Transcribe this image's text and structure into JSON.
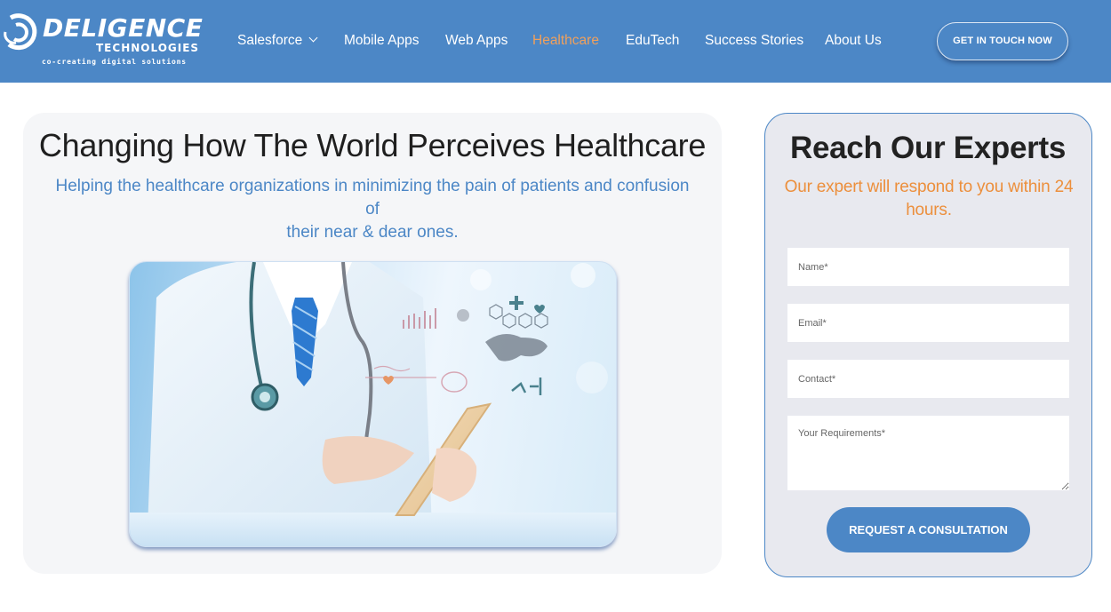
{
  "header": {
    "logo": {
      "name": "DELIGENCE",
      "sub": "TECHNOLOGIES",
      "tagline": "co-creating digital solutions"
    },
    "nav": [
      {
        "label": "Salesforce",
        "has_dropdown": true,
        "active": false
      },
      {
        "label": "Mobile Apps",
        "has_dropdown": false,
        "active": false
      },
      {
        "label": "Web Apps",
        "has_dropdown": false,
        "active": false
      },
      {
        "label": "Healthcare",
        "has_dropdown": false,
        "active": true
      },
      {
        "label": "EduTech",
        "has_dropdown": false,
        "active": false
      },
      {
        "label": "Success Stories",
        "has_dropdown": false,
        "active": false
      },
      {
        "label": "About Us",
        "has_dropdown": false,
        "active": false
      }
    ],
    "cta_label": "GET IN TOUCH NOW"
  },
  "hero": {
    "title": "Changing How The World Perceives Healthcare",
    "subtitle_line1": "Helping the healthcare organizations in minimizing the pain of patients and confusion",
    "subtitle_line2": "of",
    "subtitle_line3": "their near & dear ones.",
    "image_alt": "Doctor with stethoscope using a tablet with floating medical icons"
  },
  "form": {
    "title": "Reach Our Experts",
    "subtitle": "Our expert will respond to you within 24 hours.",
    "fields": {
      "name": {
        "placeholder": "Name*",
        "value": ""
      },
      "email": {
        "placeholder": "Email*",
        "value": ""
      },
      "contact": {
        "placeholder": "Contact*",
        "value": ""
      },
      "requirements": {
        "placeholder": "Your Requirements*",
        "value": ""
      }
    },
    "submit_label": "REQUEST A CONSULTATION"
  },
  "colors": {
    "brand_blue": "#4c87c6",
    "active_nav": "#f0a05c",
    "accent_orange": "#ec8f3c"
  }
}
